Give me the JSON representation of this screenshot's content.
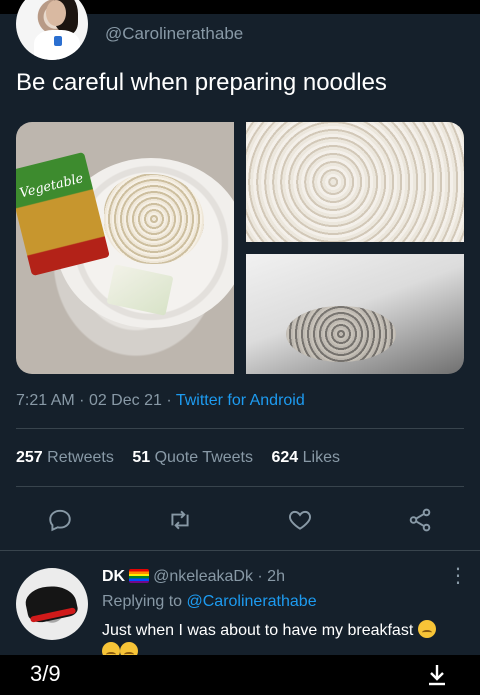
{
  "tweet": {
    "handle": "@Carolinerathabe",
    "text": "Be careful when preparing noodles",
    "time": "7:21 AM",
    "date": "02 Dec 21",
    "source": "Twitter for Android",
    "photos": [
      {
        "pack_label": "Vegetable"
      }
    ]
  },
  "stats": {
    "retweets_count": "257",
    "retweets_label": "Retweets",
    "quotes_count": "51",
    "quotes_label": "Quote Tweets",
    "likes_count": "624",
    "likes_label": "Likes"
  },
  "actions": [
    "reply-icon",
    "retweet-icon",
    "like-icon",
    "share-icon"
  ],
  "reply": {
    "name": "DK",
    "handle": "@nkeleakaDk",
    "time": "2h",
    "replying_prefix": "Replying to",
    "replying_to": "@Carolinerathabe",
    "text": "Just when I was about to have my breakfast"
  },
  "viewer": {
    "counter": "3/9"
  },
  "colors": {
    "background": "#15202b",
    "link": "#1d9bf0",
    "muted": "#8899a6"
  }
}
